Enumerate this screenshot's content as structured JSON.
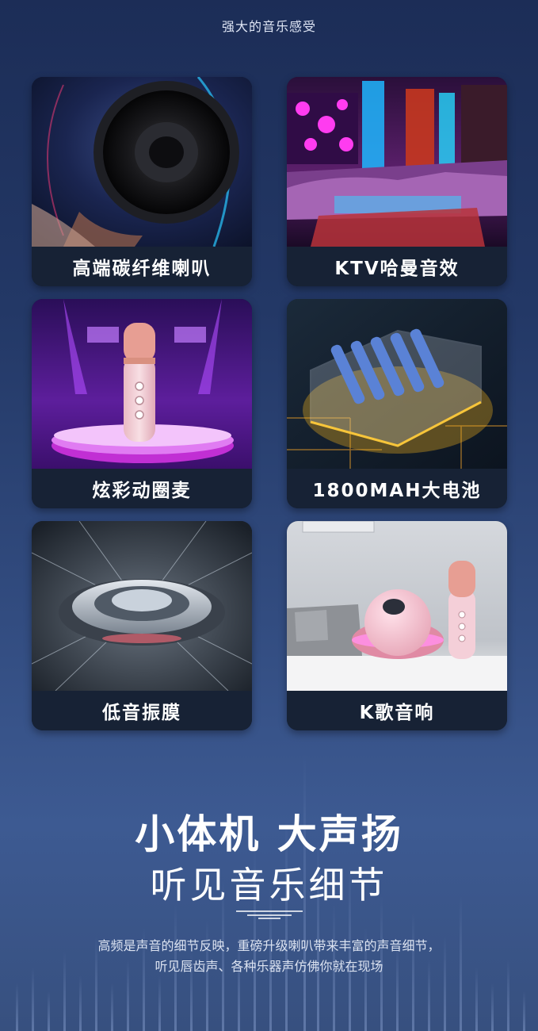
{
  "page": {
    "top_title": "强大的音乐感受"
  },
  "features": [
    {
      "caption": "高端碳纤维喇叭",
      "icon": "speaker-image"
    },
    {
      "caption": "KTV哈曼音效",
      "icon": "ktv-room-image"
    },
    {
      "caption": "炫彩动圈麦",
      "icon": "microphone-stage-image"
    },
    {
      "caption": "1800MAH大电池",
      "icon": "battery-pack-image"
    },
    {
      "caption": "低音振膜",
      "icon": "bass-diaphragm-image"
    },
    {
      "caption": "K歌音响",
      "icon": "karaoke-speaker-image"
    }
  ],
  "promo": {
    "headline": "小体机 大声扬",
    "subheadline": "听见音乐细节",
    "description_line1": "高频是声音的细节反映，重磅升级喇叭带来丰富的声音细节，",
    "description_line2": "听见唇齿声、各种乐器声仿佛你就在现场"
  },
  "colors": {
    "background_top": "#1c2d57",
    "background_bottom": "#3d5a92",
    "caption_bar": "#172235",
    "accent_pink": "#f2c4cf",
    "accent_magenta": "#d23cc8"
  }
}
